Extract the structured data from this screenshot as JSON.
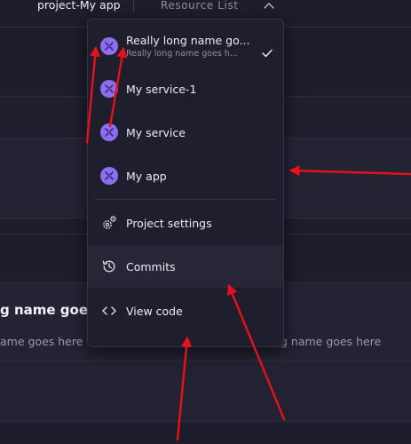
{
  "topbar": {
    "project_label": "project-My app",
    "resource_tab": "Resource List"
  },
  "background": {
    "card_title": "g name goes",
    "card_subtitle_left": "ame goes here",
    "card_subtitle_right": "g name goes here"
  },
  "menu": {
    "services": [
      {
        "label": "Really long name go...",
        "sublabel": "Really long name goes h...",
        "selected": true
      },
      {
        "label": "My service-1"
      },
      {
        "label": "My service"
      },
      {
        "label": "My app"
      }
    ],
    "actions": [
      {
        "label": "Project settings",
        "icon": "gear-icon"
      },
      {
        "label": "Commits",
        "icon": "history-icon"
      },
      {
        "label": "View code",
        "icon": "code-icon"
      }
    ]
  },
  "colors": {
    "service_icon": "#8b6ff0",
    "menu_bg": "#1e1e2c",
    "page_bg": "#1d1d2b",
    "annotation_arrow": "#e8101a"
  }
}
